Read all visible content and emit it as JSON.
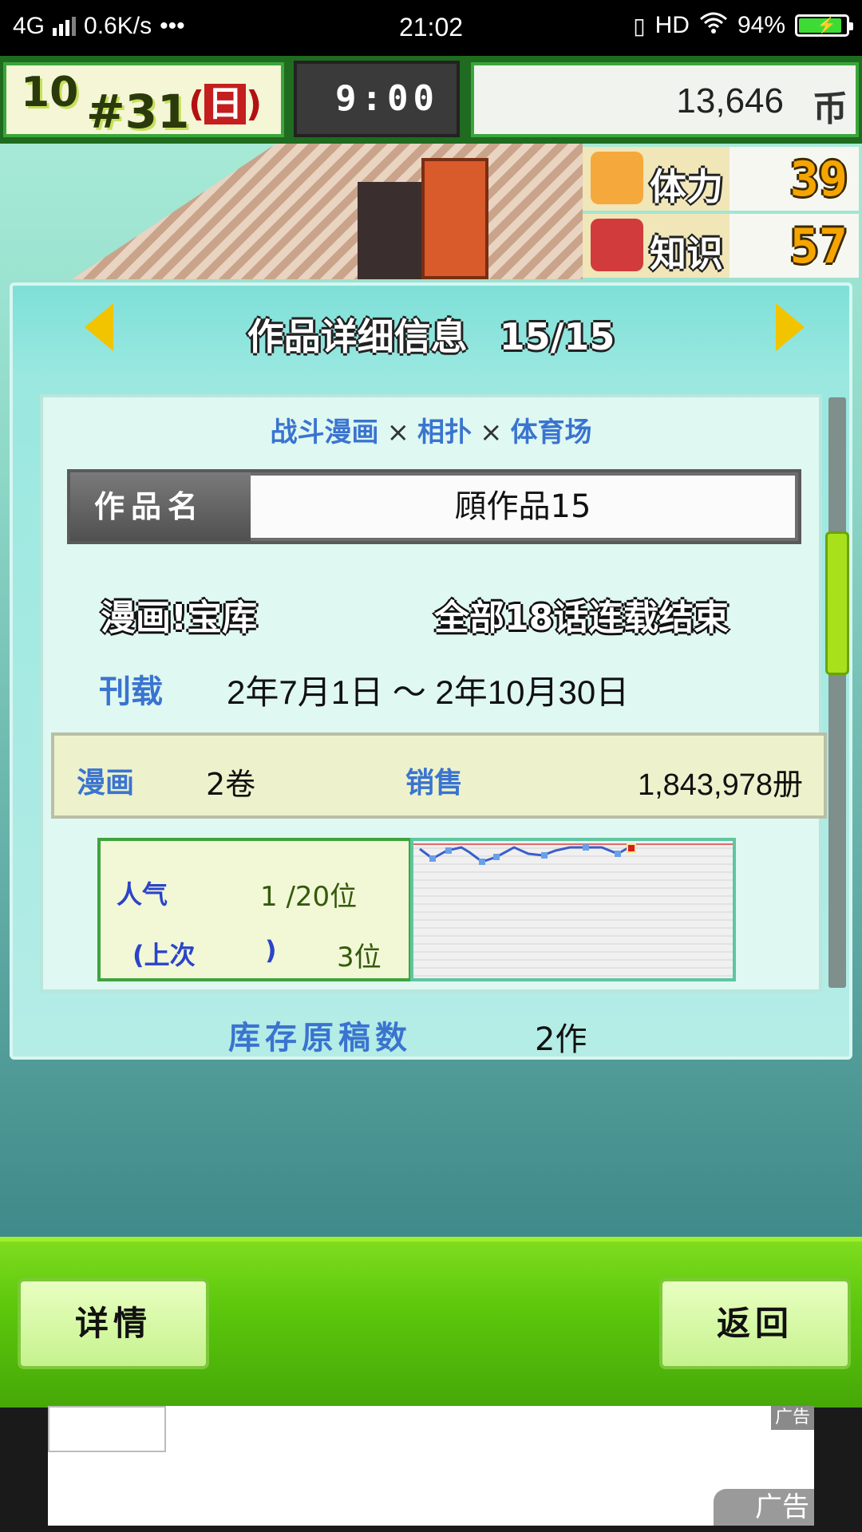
{
  "statusbar": {
    "network": "4G",
    "speed": "0.6K/s",
    "dots": "•••",
    "time": "21:02",
    "hd": "HD",
    "battery": "94%",
    "battery_level": 0.94
  },
  "hud": {
    "month": "10",
    "week": "31",
    "weekday": "日",
    "time": "9:00",
    "money": "13,646",
    "currency": "币"
  },
  "stats": [
    {
      "label": "体力",
      "value": "39",
      "icon": "flexed-arm-icon",
      "color": "#f5a93c"
    },
    {
      "label": "知识",
      "value": "57",
      "icon": "book-icon",
      "color": "#d13b3b"
    }
  ],
  "dialog": {
    "title": "作品详细信息",
    "count": "15/15",
    "genres": [
      "战斗漫画",
      "相扑",
      "体育场"
    ],
    "genre_sep": "×",
    "name_label": "作品名",
    "name_value": "頋作品15",
    "status_left": "漫画!宝库",
    "status_right": "全部18话连载结束",
    "period_label": "刊载",
    "period_value": "2年7月1日 ～ 2年10月30日",
    "manga_label": "漫画",
    "manga_value": "2卷",
    "sales_label": "销售",
    "sales_value": "1,843,978册",
    "popularity_label": "人气",
    "popularity_value": "1 /20位",
    "prev_label_open": "(上次",
    "prev_label_close": ")",
    "prev_value": "3位",
    "stock_label": "库存原稿数",
    "stock_value": "2作",
    "scroll_position": 0.3
  },
  "buttons": {
    "details": "详情",
    "back": "返回"
  },
  "ad": {
    "tag": "广告",
    "corner": "广告"
  },
  "colors": {
    "accent_blue": "#3a74d0",
    "green_bar": "#5cc70c",
    "teal_dialog": "#9ae8e0"
  }
}
